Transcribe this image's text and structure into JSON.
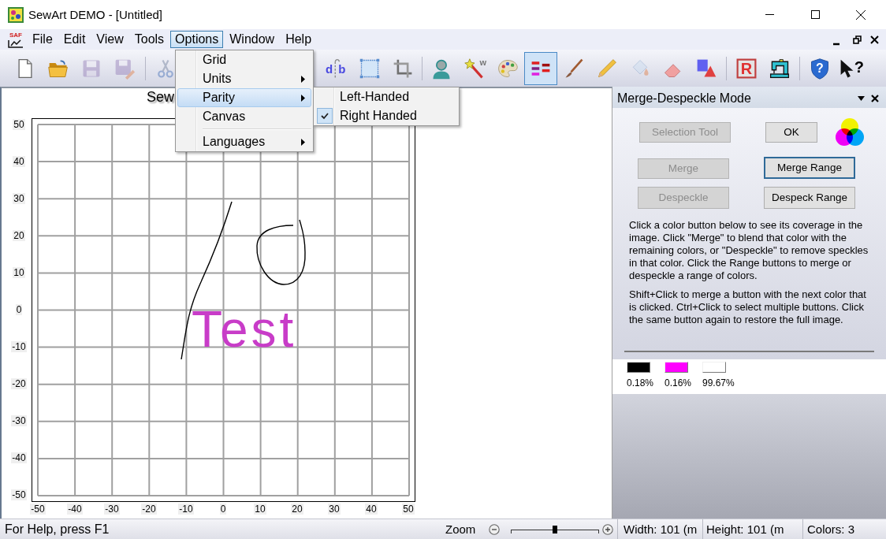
{
  "window": {
    "title": "SewArt DEMO - [Untitled]"
  },
  "menubar": {
    "logo": "SAF",
    "items": [
      {
        "label": "File",
        "selected": false
      },
      {
        "label": "Edit",
        "selected": false
      },
      {
        "label": "View",
        "selected": false
      },
      {
        "label": "Tools",
        "selected": false
      },
      {
        "label": "Options",
        "selected": true
      },
      {
        "label": "Window",
        "selected": false
      },
      {
        "label": "Help",
        "selected": false
      }
    ]
  },
  "toolbar": [
    {
      "selected": false,
      "disabled": false
    },
    {
      "selected": false,
      "disabled": false
    },
    {
      "selected": false,
      "disabled": true
    },
    {
      "selected": false,
      "disabled": true
    },
    {
      "selected": false,
      "disabled": true
    },
    {
      "selected": false,
      "disabled": false,
      "label": "db"
    },
    {
      "selected": false,
      "disabled": false
    },
    {
      "selected": false,
      "disabled": false
    },
    {
      "selected": false,
      "disabled": false
    },
    {
      "selected": false,
      "disabled": false,
      "label": "w"
    },
    {
      "selected": false,
      "disabled": false
    },
    {
      "selected": true,
      "disabled": false
    },
    {
      "selected": false,
      "disabled": false
    },
    {
      "selected": false,
      "disabled": false
    },
    {
      "selected": false,
      "disabled": true
    },
    {
      "selected": false,
      "disabled": false
    },
    {
      "selected": false,
      "disabled": false
    },
    {
      "selected": false,
      "disabled": false,
      "label": "R"
    },
    {
      "selected": false,
      "disabled": false
    },
    {
      "selected": false,
      "disabled": false,
      "label": "?"
    },
    {
      "selected": false,
      "disabled": false,
      "label": "?"
    }
  ],
  "options_menu": {
    "items": [
      {
        "kind": "item",
        "label": "Grid",
        "submenu": false,
        "selected": false
      },
      {
        "kind": "item",
        "label": "Units",
        "submenu": true,
        "selected": false
      },
      {
        "kind": "item",
        "label": "Parity",
        "submenu": true,
        "selected": true
      },
      {
        "kind": "item",
        "label": "Canvas",
        "submenu": false,
        "selected": false
      },
      {
        "kind": "separator"
      },
      {
        "kind": "item",
        "label": "Languages",
        "submenu": true,
        "selected": false
      }
    ]
  },
  "parity_submenu": {
    "items": [
      {
        "label": "Left-Handed",
        "checked": false
      },
      {
        "label": "Right Handed",
        "checked": true
      }
    ]
  },
  "canvas": {
    "title": "Sew",
    "y_labels": [
      "50",
      "40",
      "30",
      "20",
      "10",
      "0",
      "-10",
      "-20",
      "-30",
      "-40",
      "-50"
    ],
    "x_labels": [
      "-50",
      "-40",
      "-30",
      "-20",
      "-10",
      "0",
      "10",
      "20",
      "30",
      "40",
      "50"
    ],
    "handwriting": "Test"
  },
  "panel": {
    "title": "Merge-Despeckle Mode",
    "buttons": [
      {
        "label": "Selection Tool",
        "disabled": true,
        "focused": false
      },
      {
        "label": "OK",
        "disabled": false,
        "focused": false
      },
      {
        "label": "Merge",
        "disabled": true,
        "focused": false
      },
      {
        "label": "Merge Range",
        "disabled": false,
        "focused": true
      },
      {
        "label": "Despeckle",
        "disabled": true,
        "focused": false
      },
      {
        "label": "Despeck Range",
        "disabled": false,
        "focused": false
      }
    ],
    "paragraphs": [
      "Click a color button below to see its coverage in the image. Click \"Merge\" to blend that color with the remaining colors, or \"Despeckle\" to remove speckles in that color. Click the Range buttons to merge or despeckle a range of colors.",
      "Shift+Click to merge a button with the next color that is clicked. Ctrl+Click to select multiple buttons. Click the same button again to restore the full image."
    ],
    "colors": [
      {
        "color": "#000000",
        "coverage": "0.18%"
      },
      {
        "color": "#ff00ff",
        "coverage": "0.16%"
      },
      {
        "color": "#ffffff",
        "coverage": "99.67%"
      }
    ]
  },
  "status_bar": {
    "help": "For Help, press F1",
    "zoom_label": "Zoom",
    "zoom": {
      "level": 0.5
    },
    "width": "Width: 101 (m",
    "height": "Height: 101 (m",
    "colors": "Colors: 3"
  }
}
